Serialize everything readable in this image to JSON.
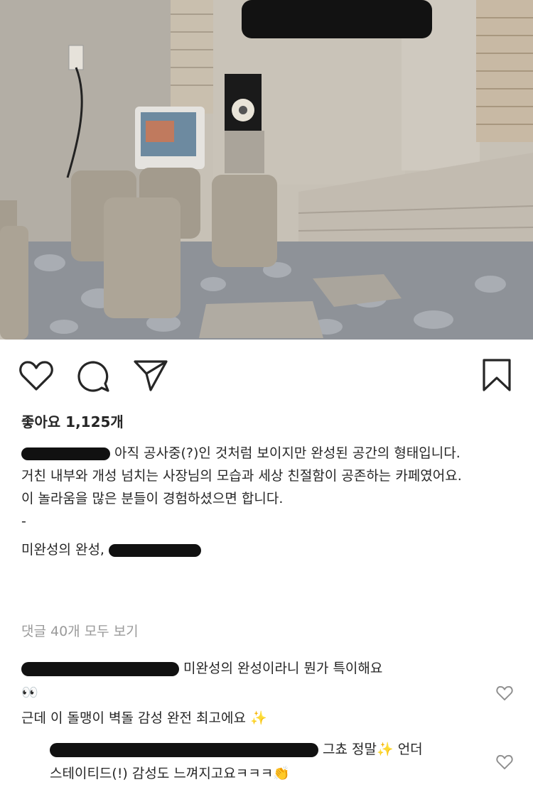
{
  "post": {
    "likes_text": "좋아요 1,125개",
    "caption_lines": [
      "아직 공사중(?)인 것처럼 보이지만 완성된 공간의 형태입니다.",
      "거친 내부와 개성 넘치는 사장님의 모습과 세상 친절함이 공존하는 카페였어요.",
      "이 놀라움을 많은 분들이 경험하셨으면 합니다.",
      "-",
      "미완성의 완성,"
    ],
    "view_all_comments": "댓글 40개 모두 보기"
  },
  "comments": [
    {
      "text": "미완성의 완성이라니 뭔가 특이해요",
      "emoji": "👀"
    },
    {
      "text": "근데 이 돌맹이 벽돌 감성 완전 최고에요 ✨"
    },
    {
      "text": "그쵸 정말✨ 언더",
      "text2": "스테이티드(!) 감성도 느껴지고요ㅋㅋㅋ👏"
    }
  ],
  "icons": {
    "like": "heart-icon",
    "comment": "comment-icon",
    "share": "send-icon",
    "save": "bookmark-icon",
    "comment_like": "heart-icon"
  }
}
